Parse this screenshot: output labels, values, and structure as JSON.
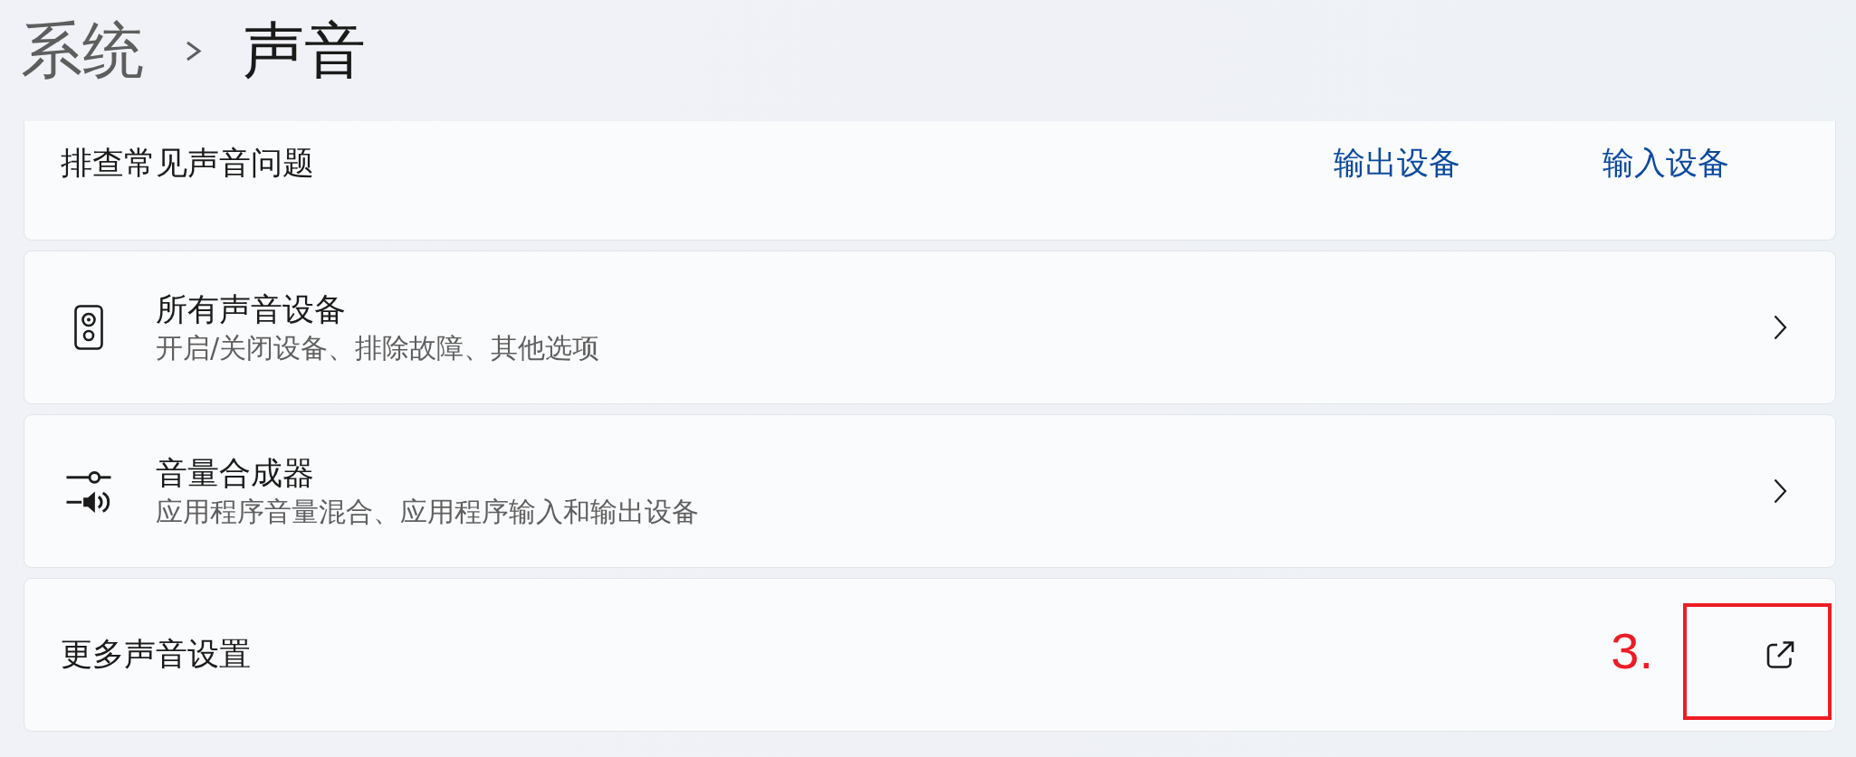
{
  "breadcrumb": {
    "parent": "系统",
    "current": "声音"
  },
  "troubleshoot": {
    "title": "排查常见声音问题",
    "links": [
      "输出设备",
      "输入设备"
    ]
  },
  "items": [
    {
      "kind": "navigate",
      "title": "所有声音设备",
      "subtitle": "开启/关闭设备、排除故障、其他选项"
    },
    {
      "kind": "navigate",
      "title": "音量合成器",
      "subtitle": "应用程序音量混合、应用程序输入和输出设备"
    },
    {
      "kind": "external",
      "title": "更多声音设置",
      "annotation": {
        "label": "3."
      }
    }
  ]
}
